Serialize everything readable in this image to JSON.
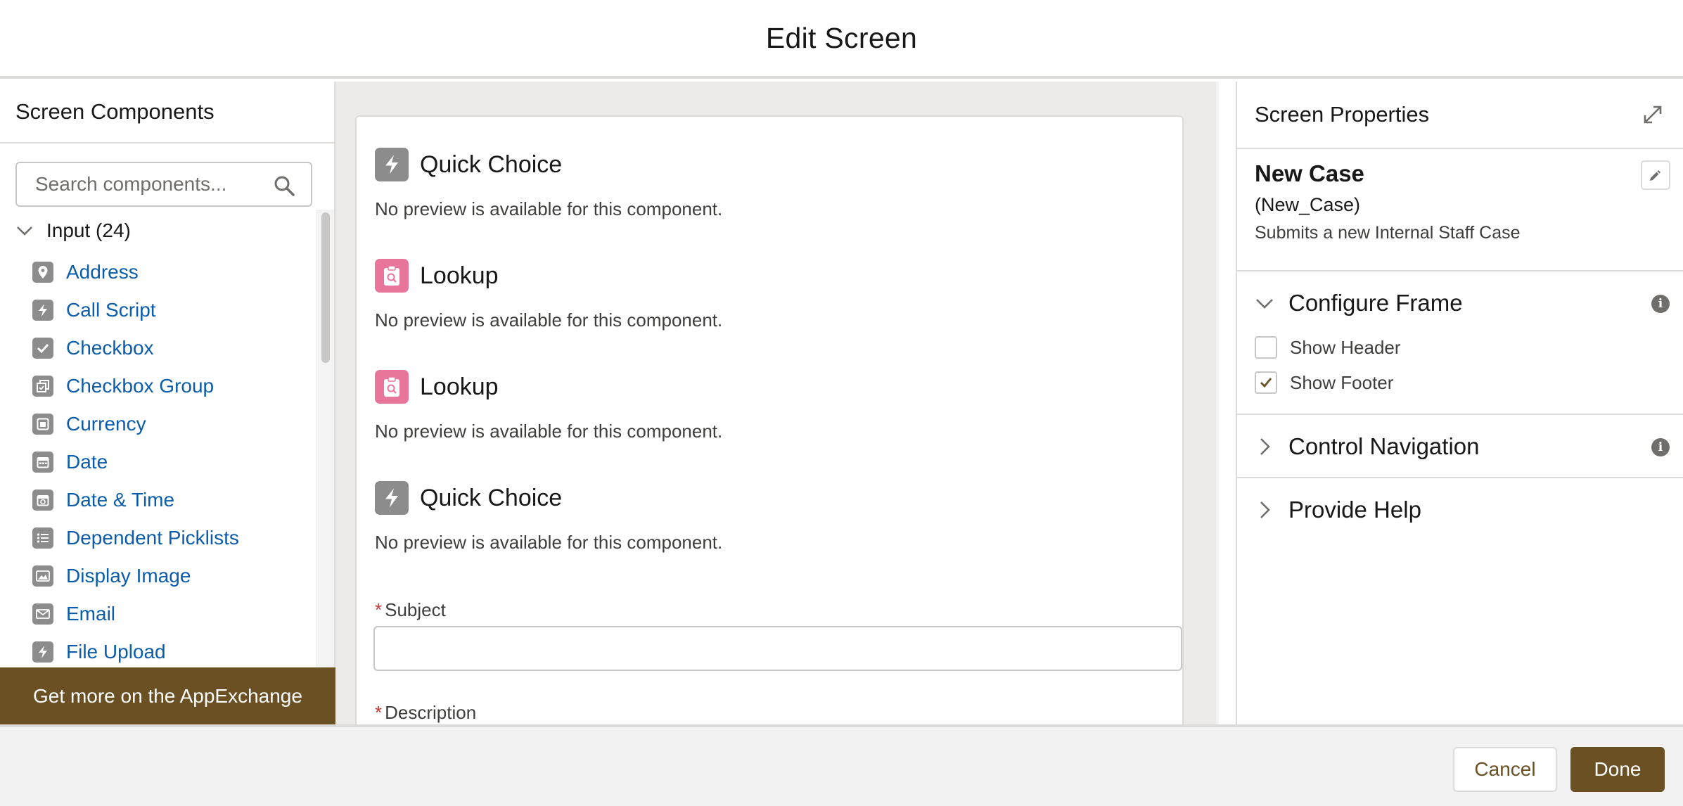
{
  "modal": {
    "title": "Edit Screen"
  },
  "left_panel": {
    "title": "Screen Components",
    "search_placeholder": "Search components...",
    "group_label": "Input (24)",
    "items": [
      {
        "label": "Address",
        "icon": "location-pin-icon"
      },
      {
        "label": "Call Script",
        "icon": "lightning-icon"
      },
      {
        "label": "Checkbox",
        "icon": "check-icon"
      },
      {
        "label": "Checkbox Group",
        "icon": "multi-check-icon"
      },
      {
        "label": "Currency",
        "icon": "currency-icon"
      },
      {
        "label": "Date",
        "icon": "calendar-icon"
      },
      {
        "label": "Date & Time",
        "icon": "calendar-clock-icon"
      },
      {
        "label": "Dependent Picklists",
        "icon": "list-icon"
      },
      {
        "label": "Display Image",
        "icon": "image-icon"
      },
      {
        "label": "Email",
        "icon": "email-icon"
      },
      {
        "label": "File Upload",
        "icon": "lightning-icon"
      }
    ],
    "appexchange_label": "Get more on the AppExchange"
  },
  "canvas": {
    "components": [
      {
        "title": "Quick Choice",
        "note": "No preview is available for this component.",
        "icon": "lightning-icon",
        "color": "#8c8c8c"
      },
      {
        "title": "Lookup",
        "note": "No preview is available for this component.",
        "icon": "lookup-icon",
        "color": "#e8769a"
      },
      {
        "title": "Lookup",
        "note": "No preview is available for this component.",
        "icon": "lookup-icon",
        "color": "#e8769a"
      },
      {
        "title": "Quick Choice",
        "note": "No preview is available for this component.",
        "icon": "lightning-icon",
        "color": "#8c8c8c"
      }
    ],
    "subject_label": "Subject",
    "subject_value": "",
    "description_label": "Description",
    "required_marker": "*"
  },
  "right_panel": {
    "title": "Screen Properties",
    "screen_label": "New Case",
    "api_name": "(New_Case)",
    "description": "Submits a new Internal Staff Case",
    "configure_frame": {
      "title": "Configure Frame",
      "show_header_label": "Show Header",
      "show_header_checked": false,
      "show_footer_label": "Show Footer",
      "show_footer_checked": true
    },
    "control_navigation_title": "Control Navigation",
    "provide_help_title": "Provide Help"
  },
  "footer": {
    "cancel_label": "Cancel",
    "done_label": "Done"
  },
  "colors": {
    "brand": "#6b5023",
    "link": "#0b5cab",
    "required": "#c23934"
  }
}
